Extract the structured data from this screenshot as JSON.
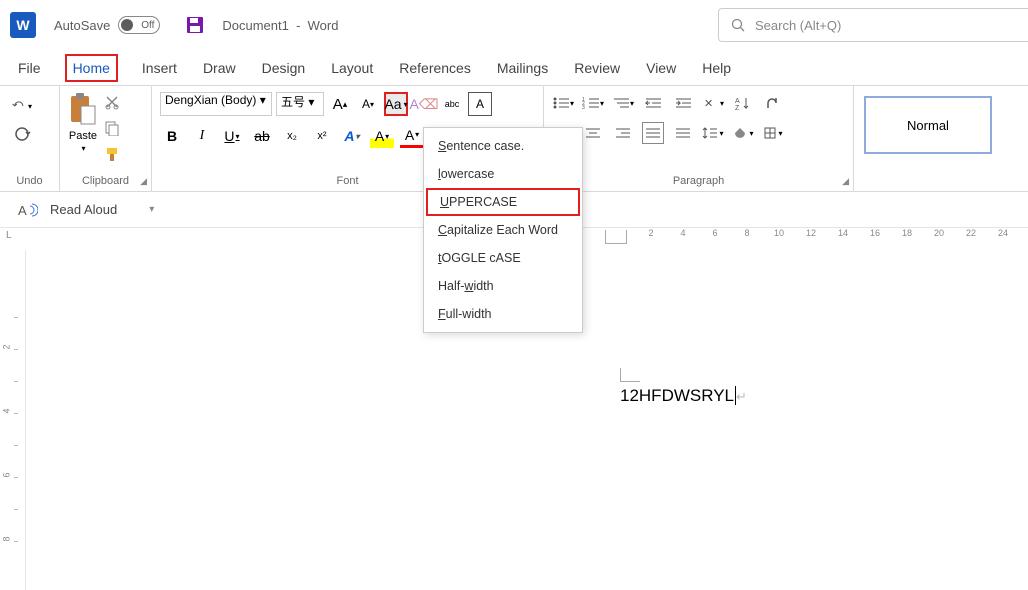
{
  "titlebar": {
    "autosave_label": "AutoSave",
    "autosave_state": "Off",
    "doc_name": "Document1",
    "app_name": "Word",
    "search_placeholder": "Search (Alt+Q)"
  },
  "tabs": {
    "file": "File",
    "home": "Home",
    "insert": "Insert",
    "draw": "Draw",
    "design": "Design",
    "layout": "Layout",
    "references": "References",
    "mailings": "Mailings",
    "review": "Review",
    "view": "View",
    "help": "Help"
  },
  "ribbon": {
    "undo_label": "Undo",
    "clipboard_label": "Clipboard",
    "paste_label": "Paste",
    "font_label": "Font",
    "font_name": "DengXian (Body)",
    "font_size": "五号",
    "bold": "B",
    "italic": "I",
    "underline": "U",
    "strike": "ab",
    "sub": "x₂",
    "super": "x²",
    "effects": "A",
    "highlight": "A",
    "fontcolor": "A",
    "grow": "A",
    "shrink": "A",
    "case": "Aa",
    "clear": "A",
    "phonetic": "abc",
    "charborder": "A",
    "para_label": "Paragraph",
    "styles_label": "",
    "normal_style": "Normal"
  },
  "case_menu": {
    "sentence": "Sentence case.",
    "lower": "lowercase",
    "upper": "UPPERCASE",
    "capitalize": "Capitalize Each Word",
    "toggle": "tOGGLE cASE",
    "halfwidth": "Half-width",
    "fullwidth": "Full-width"
  },
  "readbar": {
    "label": "Read Aloud"
  },
  "ruler": {
    "h": [
      "2",
      "4",
      "6",
      "8",
      "10",
      "12",
      "14",
      "16",
      "18",
      "20",
      "22",
      "24"
    ],
    "v": [
      "",
      "2",
      "",
      "4",
      "",
      "6",
      "",
      "8"
    ]
  },
  "document": {
    "text": "12HFDWSRYL"
  }
}
